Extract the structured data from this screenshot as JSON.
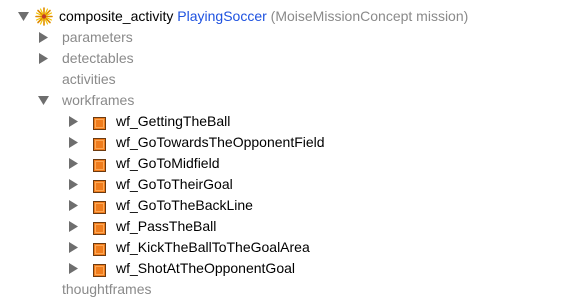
{
  "root": {
    "keyword": "composite_activity",
    "name": "PlayingSoccer",
    "qualifier": "(MoiseMissionConcept mission)",
    "icon": "activity-burst-icon"
  },
  "children": {
    "parameters": "parameters",
    "detectables": "detectables",
    "activities": "activities",
    "workframes": "workframes",
    "thoughtframes": "thoughtframes"
  },
  "workframes": [
    "wf_GettingTheBall",
    "wf_GoTowardsTheOpponentField",
    "wf_GoToMidfield",
    "wf_GoToTheirGoal",
    "wf_GoToTheBackLine",
    "wf_PassTheBall",
    "wf_KickTheBallToTheGoalArea",
    "wf_ShotAtTheOpponentGoal"
  ],
  "colors": {
    "keyword": "#000000",
    "name": "#1e52e0",
    "secondary": "#8a8a8a",
    "workframe_icon_fill": "#f07c1c",
    "workframe_icon_border": "#6b3a10",
    "disclosure": "#6e6e6e"
  }
}
